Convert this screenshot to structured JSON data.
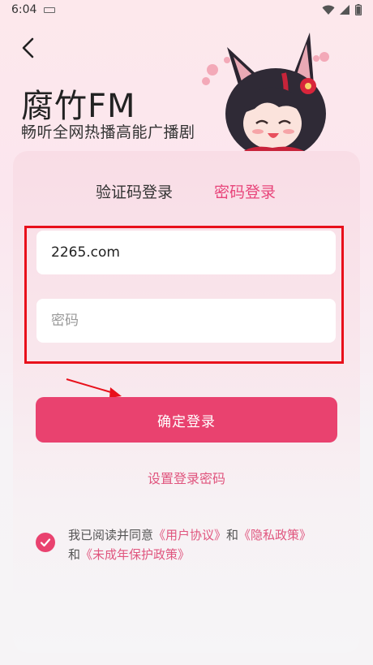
{
  "status_bar": {
    "time": "6:04",
    "icons": [
      "notification-icon",
      "wifi-icon",
      "signal-icon",
      "battery-icon"
    ]
  },
  "header": {
    "title": "腐竹FM",
    "subtitle": "畅听全网热播高能广播剧"
  },
  "tabs": [
    {
      "label": "验证码登录",
      "active": false
    },
    {
      "label": "密码登录",
      "active": true
    }
  ],
  "form": {
    "account_value": "2265.com",
    "password_placeholder": "密码",
    "password_value": ""
  },
  "login_button_label": "确定登录",
  "set_password_link": "设置登录密码",
  "agreement": {
    "checked": true,
    "prefix": "我已阅读并同意",
    "user_agreement": "《用户协议》",
    "and1": "和",
    "privacy_policy": "《隐私政策》",
    "and2": "和",
    "minor_policy": "《未成年保护政策》"
  },
  "colors": {
    "accent": "#e9426f",
    "link": "#e0557e",
    "annotation": "#e8101b"
  }
}
